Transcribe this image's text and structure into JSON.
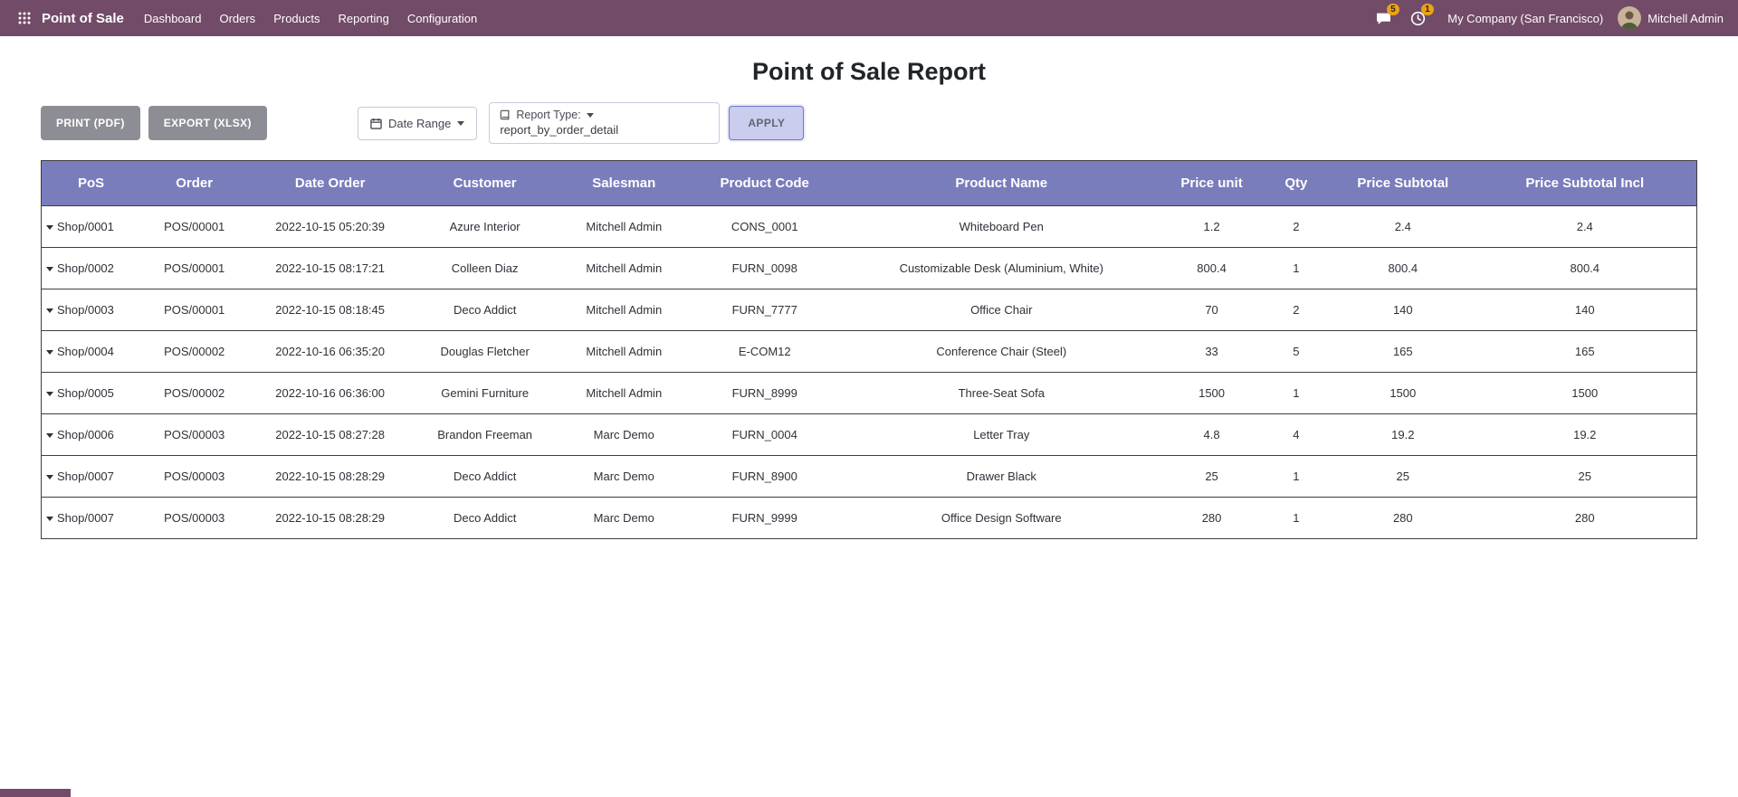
{
  "nav": {
    "brand": "Point of Sale",
    "items": [
      "Dashboard",
      "Orders",
      "Products",
      "Reporting",
      "Configuration"
    ],
    "messages_badge": "5",
    "activities_badge": "1",
    "company": "My Company (San Francisco)",
    "user": "Mitchell Admin"
  },
  "page": {
    "title": "Point of Sale Report"
  },
  "toolbar": {
    "print_label": "PRINT (PDF)",
    "export_label": "EXPORT (XLSX)",
    "date_range_label": "Date Range",
    "report_type_label": "Report Type:",
    "report_type_value": "report_by_order_detail",
    "apply_label": "APPLY"
  },
  "table": {
    "headers": [
      "PoS",
      "Order",
      "Date Order",
      "Customer",
      "Salesman",
      "Product Code",
      "Product Name",
      "Price unit",
      "Qty",
      "Price Subtotal",
      "Price Subtotal Incl"
    ],
    "rows": [
      [
        "Shop/0001",
        "POS/00001",
        "2022-10-15 05:20:39",
        "Azure Interior",
        "Mitchell Admin",
        "CONS_0001",
        "Whiteboard Pen",
        "1.2",
        "2",
        "2.4",
        "2.4"
      ],
      [
        "Shop/0002",
        "POS/00001",
        "2022-10-15 08:17:21",
        "Colleen Diaz",
        "Mitchell Admin",
        "FURN_0098",
        "Customizable Desk (Aluminium, White)",
        "800.4",
        "1",
        "800.4",
        "800.4"
      ],
      [
        "Shop/0003",
        "POS/00001",
        "2022-10-15 08:18:45",
        "Deco Addict",
        "Mitchell Admin",
        "FURN_7777",
        "Office Chair",
        "70",
        "2",
        "140",
        "140"
      ],
      [
        "Shop/0004",
        "POS/00002",
        "2022-10-16 06:35:20",
        "Douglas Fletcher",
        "Mitchell Admin",
        "E-COM12",
        "Conference Chair (Steel)",
        "33",
        "5",
        "165",
        "165"
      ],
      [
        "Shop/0005",
        "POS/00002",
        "2022-10-16 06:36:00",
        "Gemini Furniture",
        "Mitchell Admin",
        "FURN_8999",
        "Three-Seat Sofa",
        "1500",
        "1",
        "1500",
        "1500"
      ],
      [
        "Shop/0006",
        "POS/00003",
        "2022-10-15 08:27:28",
        "Brandon Freeman",
        "Marc Demo",
        "FURN_0004",
        "Letter Tray",
        "4.8",
        "4",
        "19.2",
        "19.2"
      ],
      [
        "Shop/0007",
        "POS/00003",
        "2022-10-15 08:28:29",
        "Deco Addict",
        "Marc Demo",
        "FURN_8900",
        "Drawer Black",
        "25",
        "1",
        "25",
        "25"
      ],
      [
        "Shop/0007",
        "POS/00003",
        "2022-10-15 08:28:29",
        "Deco Addict",
        "Marc Demo",
        "FURN_9999",
        "Office Design Software",
        "280",
        "1",
        "280",
        "280"
      ]
    ]
  },
  "icons": {
    "apps_grid": "grid-of-dots",
    "messages": "chat-bubble",
    "activities": "clock",
    "date_range": "calendar",
    "report_type": "book",
    "row_expand": "caret-down"
  },
  "colors": {
    "navbar": "#714B67",
    "table_header": "#797dbb",
    "badge": "#e9a21b",
    "apply_bg": "#cacded",
    "muted_button": "#8d8d96"
  }
}
